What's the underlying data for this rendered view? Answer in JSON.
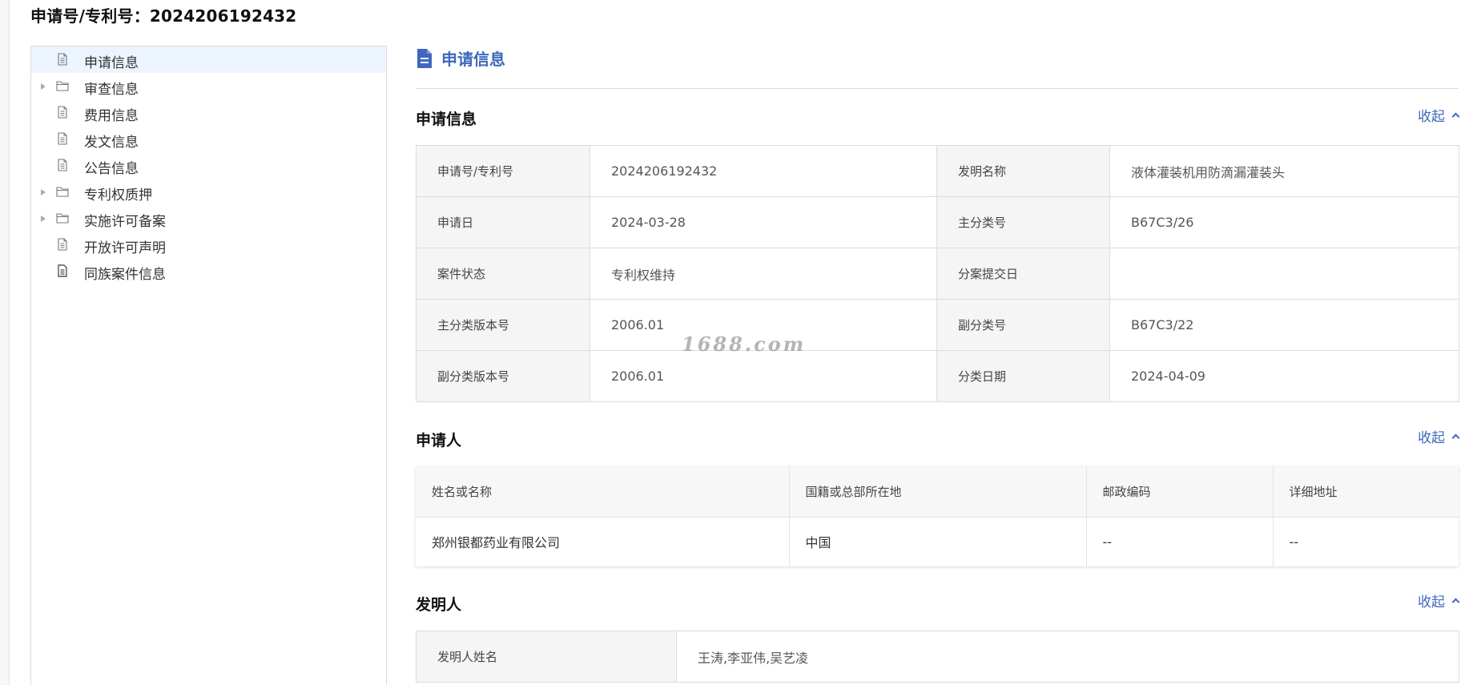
{
  "header": {
    "title": "申请号/专利号：2024206192432"
  },
  "sidebar": {
    "items": [
      {
        "label": "申请信息",
        "icon": "document-icon",
        "expandable": false,
        "selected": true
      },
      {
        "label": "审查信息",
        "icon": "folder-icon",
        "expandable": true,
        "selected": false
      },
      {
        "label": "费用信息",
        "icon": "document-icon",
        "expandable": false,
        "selected": false
      },
      {
        "label": "发文信息",
        "icon": "document-icon",
        "expandable": false,
        "selected": false
      },
      {
        "label": "公告信息",
        "icon": "document-icon",
        "expandable": false,
        "selected": false
      },
      {
        "label": "专利权质押",
        "icon": "folder-icon",
        "expandable": true,
        "selected": false
      },
      {
        "label": "实施许可备案",
        "icon": "folder-icon",
        "expandable": true,
        "selected": false
      },
      {
        "label": "开放许可声明",
        "icon": "document-icon",
        "expandable": false,
        "selected": false
      },
      {
        "label": "同族案件信息",
        "icon": "document-filled-icon",
        "expandable": false,
        "selected": false
      }
    ]
  },
  "main": {
    "section_title": "申请信息",
    "collapse_label": "收起",
    "app_info": {
      "title": "申请信息",
      "rows": [
        {
          "l1": "申请号/专利号",
          "v1": "2024206192432",
          "l2": "发明名称",
          "v2": "液体灌装机用防滴漏灌装头"
        },
        {
          "l1": "申请日",
          "v1": "2024-03-28",
          "l2": "主分类号",
          "v2": "B67C3/26"
        },
        {
          "l1": "案件状态",
          "v1": "专利权维持",
          "l2": "分案提交日",
          "v2": ""
        },
        {
          "l1": "主分类版本号",
          "v1": "2006.01",
          "l2": "副分类号",
          "v2": "B67C3/22"
        },
        {
          "l1": "副分类版本号",
          "v1": "2006.01",
          "l2": "分类日期",
          "v2": "2024-04-09"
        }
      ]
    },
    "applicant": {
      "title": "申请人",
      "headers": [
        "姓名或名称",
        "国籍或总部所在地",
        "邮政编码",
        "详细地址"
      ],
      "rows": [
        [
          "郑州银都药业有限公司",
          "中国",
          "--",
          "--"
        ]
      ]
    },
    "inventor": {
      "title": "发明人",
      "label": "发明人姓名",
      "value": "王涛,李亚伟,吴艺凌"
    }
  },
  "watermark": "1688.com",
  "colors": {
    "accent": "#3f68bd",
    "selected_bg": "#ecf4ff",
    "label_bg": "#f5f5f5",
    "border": "#dcdcdc"
  }
}
